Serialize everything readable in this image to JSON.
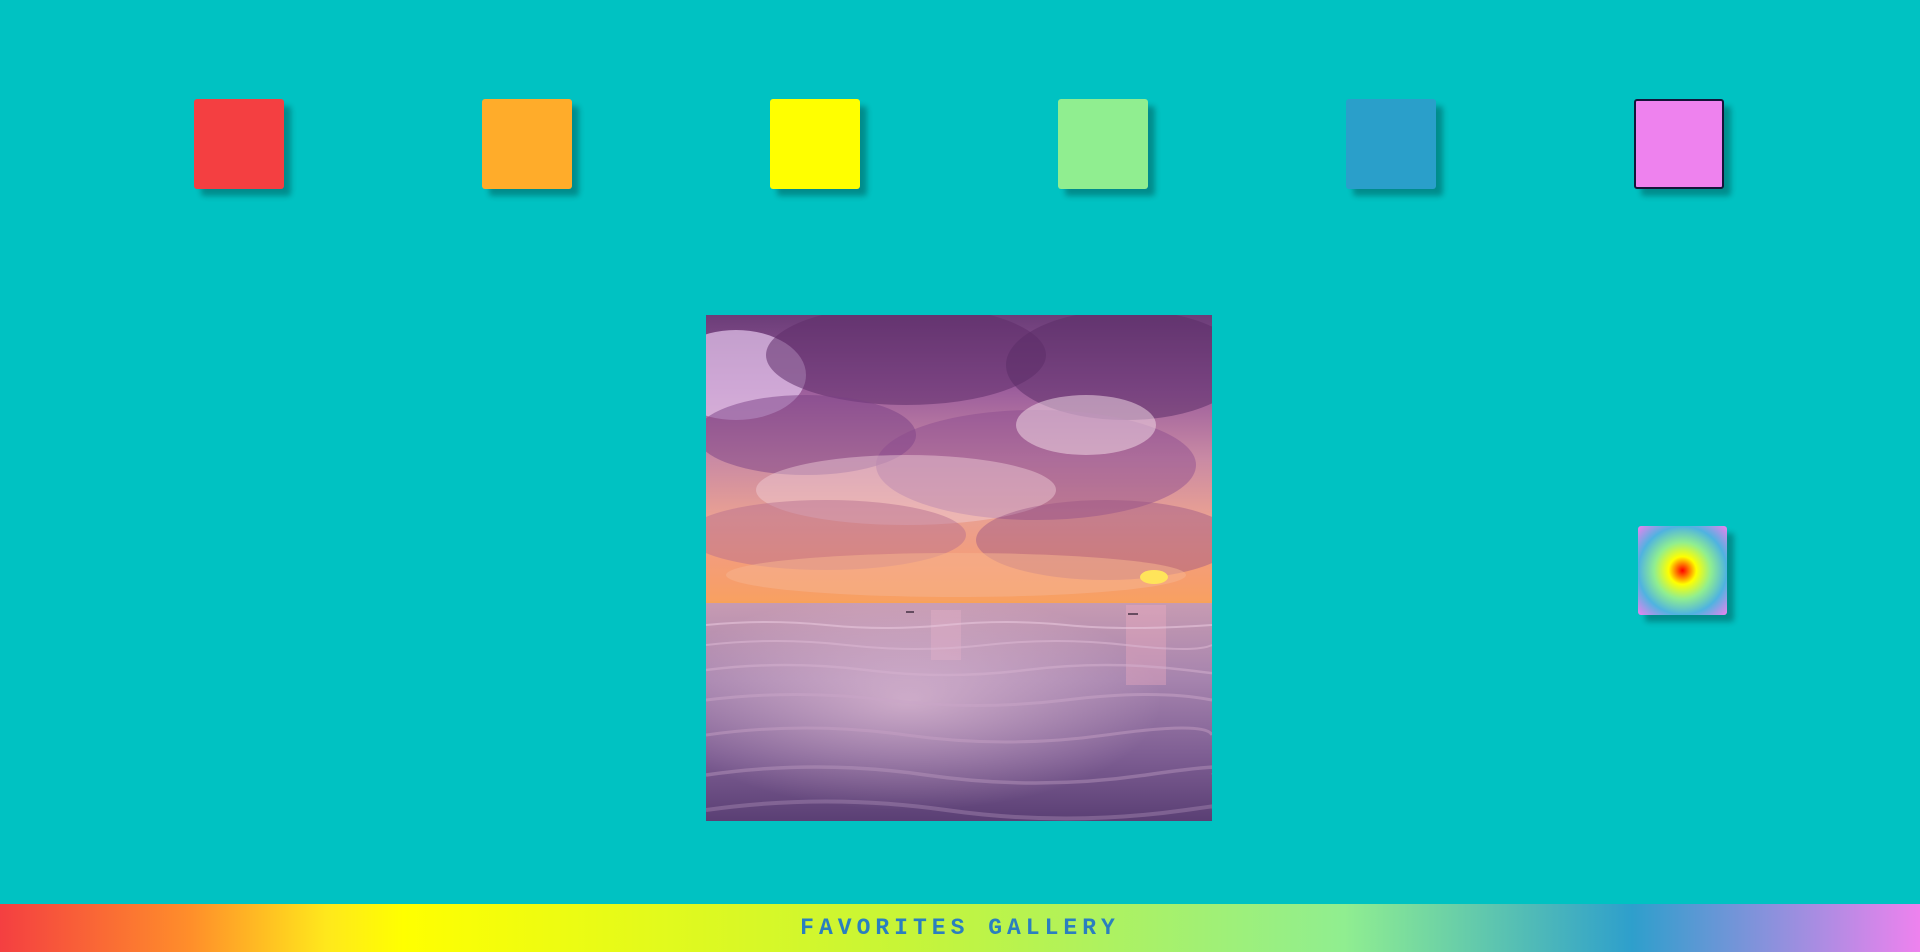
{
  "palette": {
    "swatches": [
      {
        "name": "red",
        "color": "#F43F41",
        "selected": false
      },
      {
        "name": "orange",
        "color": "#FFAC2A",
        "selected": false
      },
      {
        "name": "yellow",
        "color": "#FFFF00",
        "selected": false
      },
      {
        "name": "light-green",
        "color": "#90EE90",
        "selected": false
      },
      {
        "name": "blue",
        "color": "#2A9FCA",
        "selected": false
      },
      {
        "name": "violet",
        "color": "#EE82EE",
        "selected": true
      }
    ],
    "gradient_button": {
      "name": "radial-gradient",
      "colors": [
        "#FF0000",
        "#FFFF00",
        "#90EE90",
        "#4FB3E0",
        "#EE82EE"
      ]
    }
  },
  "viewer": {
    "image_name": "sunset-over-sea"
  },
  "footer": {
    "title": "FAVORITES GALLERY"
  }
}
